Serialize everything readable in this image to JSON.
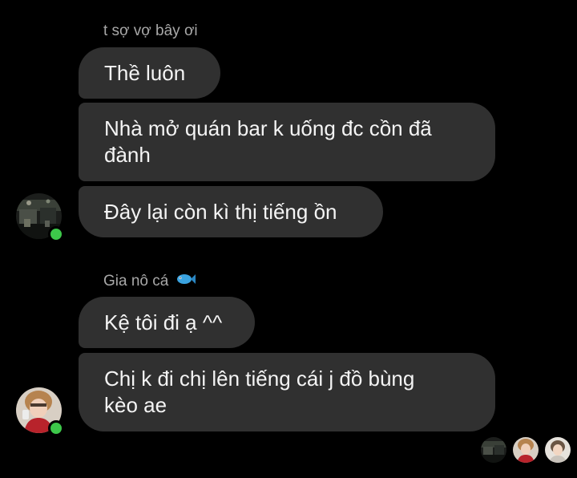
{
  "conversation": {
    "group_1": {
      "sender_name": "t sợ vợ bây ơi",
      "messages": [
        "Thề luôn",
        "Nhà mở quán bar k uống đc cồn đã",
        "đành",
        "Đây lại còn kì thị tiếng ồn"
      ]
    },
    "group_2": {
      "sender_name": "Gia nô cá",
      "name_emoji": "fish-emoji",
      "messages": [
        "Kệ tôi đi ạ ^^",
        "Chị k đi chị lên tiếng cái j đồ bùng",
        "kèo ae"
      ]
    }
  },
  "colors": {
    "background": "#000000",
    "bubble": "#303030",
    "name_text": "#a8a8a8",
    "online": "#3dc84a"
  }
}
